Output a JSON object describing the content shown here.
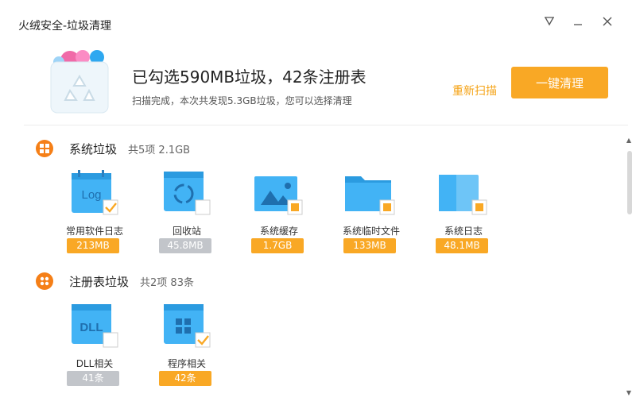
{
  "window": {
    "title": "火绒安全-垃圾清理"
  },
  "header": {
    "headline": "已勾选590MB垃圾，42条注册表",
    "subline": "扫描完成，本次共发现5.3GB垃圾，您可以选择清理",
    "rescan_label": "重新扫描",
    "clean_label": "一键清理"
  },
  "sections": [
    {
      "title": "系统垃圾",
      "count": "共5项 2.1GB",
      "items": [
        {
          "label": "常用软件日志",
          "size": "213MB",
          "checked": true
        },
        {
          "label": "回收站",
          "size": "45.8MB",
          "checked": false
        },
        {
          "label": "系统缓存",
          "size": "1.7GB",
          "checked": "partial"
        },
        {
          "label": "系统临时文件",
          "size": "133MB",
          "checked": "partial"
        },
        {
          "label": "系统日志",
          "size": "48.1MB",
          "checked": "partial"
        }
      ]
    },
    {
      "title": "注册表垃圾",
      "count": "共2项 83条",
      "items": [
        {
          "label": "DLL相关",
          "size": "41条",
          "checked": false
        },
        {
          "label": "程序相关",
          "size": "42条",
          "checked": true
        }
      ]
    }
  ],
  "icons": {
    "log_text": "Log",
    "dll_text": "DLL"
  },
  "colors": {
    "accent": "#f9a825",
    "tile_blue": "#42b3f5",
    "disabled": "#c2c5ca"
  }
}
